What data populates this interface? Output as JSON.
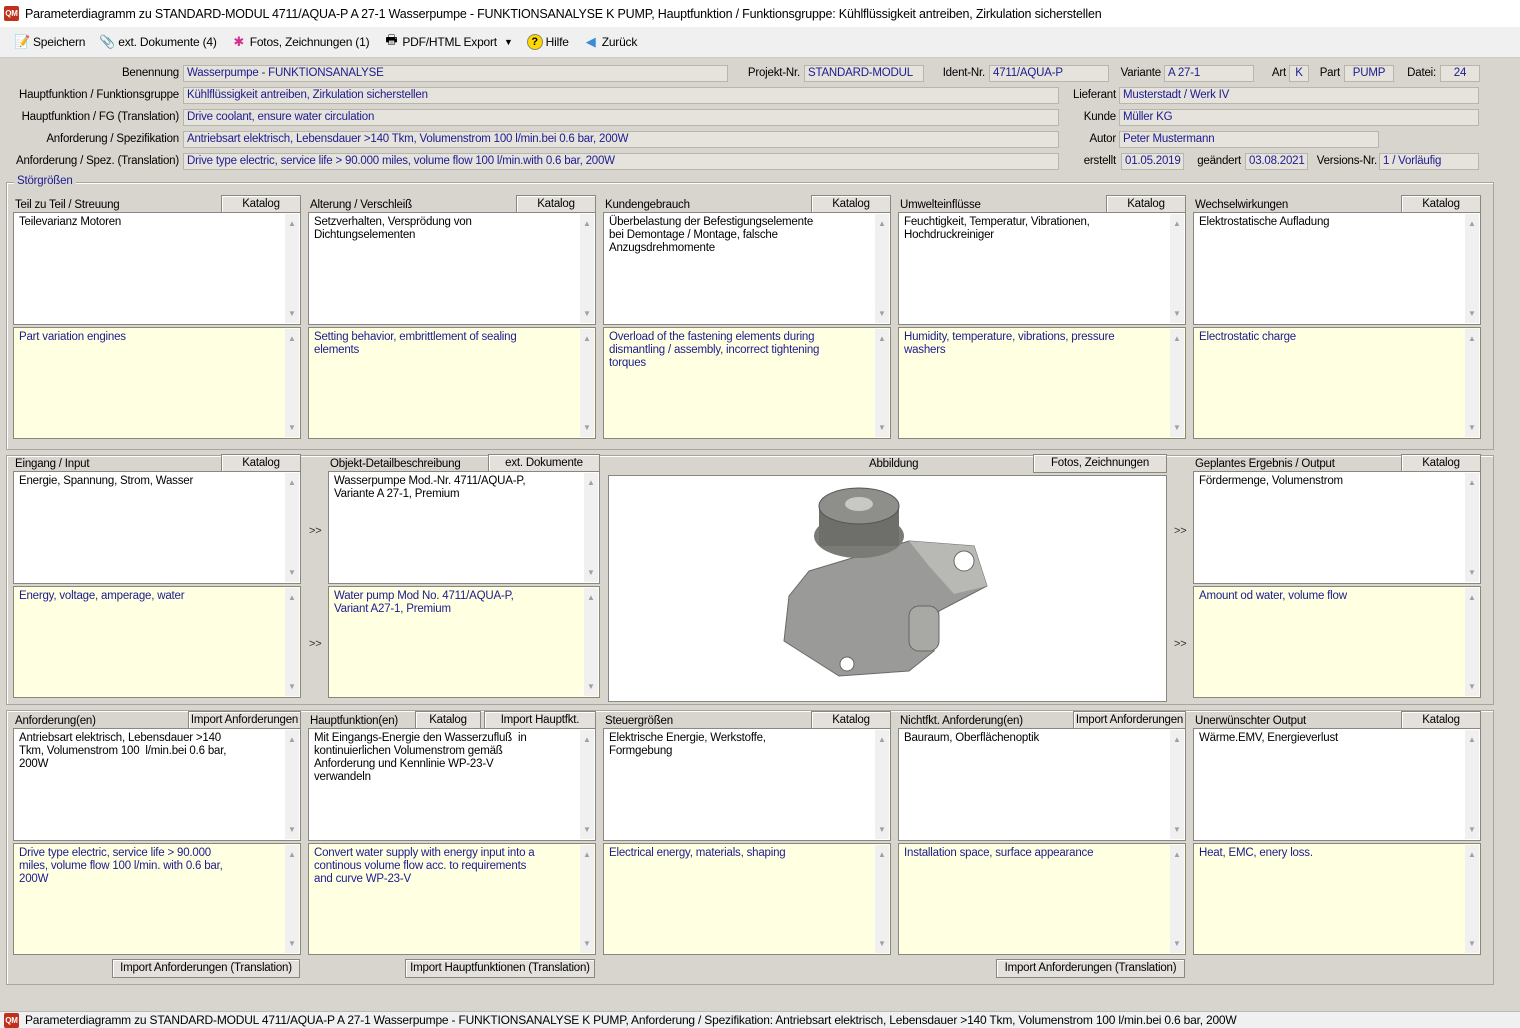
{
  "window": {
    "title": "Parameterdiagramm zu STANDARD-MODUL  4711/AQUA-P  A 27-1  Wasserpumpe - FUNKTIONSANALYSE  K  PUMP, Hauptfunktion / Funktionsgruppe: Kühlflüssigkeit antreiben, Zirkulation sicherstellen",
    "app_icon": "QM"
  },
  "toolbar": {
    "save": "Speichern",
    "ext_docs": "ext. Dokumente (4)",
    "photos": "Fotos, Zeichnungen (1)",
    "export": "PDF/HTML Export",
    "help": "Hilfe",
    "back": "Zurück"
  },
  "header": {
    "benennung_label": "Benennung",
    "benennung": "Wasserpumpe - FUNKTIONSANALYSE",
    "projekt_label": "Projekt-Nr.",
    "projekt": "STANDARD-MODUL",
    "ident_label": "Ident-Nr.",
    "ident": "4711/AQUA-P",
    "variante_label": "Variante",
    "variante": "A 27-1",
    "art_label": "Art",
    "art": "K",
    "part_label": "Part",
    "part": "PUMP",
    "datei_label": "Datei:",
    "datei": "24",
    "hf_label": "Hauptfunktion / Funktionsgruppe",
    "hf": "Kühlflüssigkeit antreiben, Zirkulation sicherstellen",
    "hf_tr_label": "Hauptfunktion / FG (Translation)",
    "hf_tr": "Drive coolant, ensure water circulation",
    "anf_label": "Anforderung / Spezifikation",
    "anf": "Antriebsart elektrisch, Lebensdauer >140 Tkm, Volumenstrom 100  l/min.bei 0.6 bar, 200W",
    "anf_tr_label": "Anforderung / Spez. (Translation)",
    "anf_tr": "Drive type electric, service life > 90.000 miles, volume flow 100  l/min.with 0.6 bar, 200W",
    "lieferant_label": "Lieferant",
    "lieferant": "Musterstadt / Werk IV",
    "kunde_label": "Kunde",
    "kunde": "Müller KG",
    "autor_label": "Autor",
    "autor": "Peter Mustermann",
    "erstellt_label": "erstellt",
    "erstellt": "01.05.2019",
    "geaendert_label": "geändert",
    "geaendert": "03.08.2021",
    "version_label": "Versions-Nr.",
    "version": "1 / Vorläufig"
  },
  "stoer": {
    "title": "Störgrößen",
    "columns": [
      {
        "title": "Teil zu Teil / Streuung",
        "buttons": [
          "Katalog"
        ],
        "de": "Teilevarianz Motoren",
        "en": "Part variation engines"
      },
      {
        "title": "Alterung / Verschleiß",
        "buttons": [
          "Katalog"
        ],
        "de": "Setzverhalten, Versprödung von\nDichtungselementen",
        "en": "Setting behavior, embrittlement of sealing\nelements"
      },
      {
        "title": "Kundengebrauch",
        "buttons": [
          "Katalog"
        ],
        "de": "Überbelastung der Befestigungselemente\nbei Demontage / Montage, falsche\nAnzugsdrehmomente",
        "en": "Overload of the fastening elements during\ndismantling / assembly, incorrect tightening\ntorques"
      },
      {
        "title": "Umwelteinflüsse",
        "buttons": [
          "Katalog"
        ],
        "de": "Feuchtigkeit, Temperatur, Vibrationen,\nHochdruckreiniger",
        "en": "Humidity, temperature, vibrations, pressure\nwashers"
      },
      {
        "title": "Wechselwirkungen",
        "buttons": [
          "Katalog"
        ],
        "de": "Elektrostatische Aufladung",
        "en": "Electrostatic charge"
      }
    ]
  },
  "middle": {
    "input": {
      "title": "Eingang / Input",
      "buttons": [
        "Katalog"
      ],
      "de": "Energie, Spannung, Strom, Wasser",
      "en": "Energy, voltage, amperage, water"
    },
    "object": {
      "title": "Objekt-Detailbeschreibung",
      "buttons": [
        "ext. Dokumente"
      ],
      "de": "Wasserpumpe Mod.-Nr. 4711/AQUA-P,\nVariante A 27-1, Premium",
      "en": "Water pump Mod No. 4711/AQUA-P,\nVariant A27-1, Premium"
    },
    "image": {
      "title": "Abbildung",
      "button": "Fotos, Zeichnungen"
    },
    "output": {
      "title": "Geplantes Ergebnis / Output",
      "buttons": [
        "Katalog"
      ],
      "de": "Fördermenge, Volumenstrom",
      "en": "Amount od water, volume flow"
    },
    "arrow": ">>"
  },
  "bottom": {
    "columns": [
      {
        "title": "Anforderung(en)",
        "buttons": [
          "Import Anforderungen"
        ],
        "de": "Antriebsart elektrisch, Lebensdauer >140\nTkm, Volumenstrom 100  l/min.bei 0.6 bar,\n200W",
        "en": "Drive type electric, service life > 90.000\nmiles, volume flow 100 l/min. with 0.6 bar,\n200W"
      },
      {
        "title": "Hauptfunktion(en)",
        "buttons": [
          "Katalog",
          "Import Hauptfkt."
        ],
        "de": "Mit Eingangs-Energie den Wasserzufluß  in\nkontinuierlichen Volumenstrom gemäß\nAnforderung und Kennlinie WP-23-V\nverwandeln",
        "en": "Convert water supply with energy input into a\ncontinous volume flow acc. to requirements\nand curve WP-23-V"
      },
      {
        "title": "Steuergrößen",
        "buttons": [
          "Katalog"
        ],
        "de": "Elektrische Energie, Werkstoffe,\nFormgebung",
        "en": "Electrical energy, materials, shaping"
      },
      {
        "title": "Nichtfkt. Anforderung(en)",
        "buttons": [
          "Import Anforderungen"
        ],
        "de": "Bauraum, Oberflächenoptik",
        "en": "Installation space, surface appearance"
      },
      {
        "title": "Unerwünschter Output",
        "buttons": [
          "Katalog"
        ],
        "de": "Wärme.EMV, Energieverlust",
        "en": "Heat, EMC, enery loss."
      }
    ],
    "import_buttons": [
      "Import Anforderungen (Translation)",
      "Import Hauptfunktionen (Translation)",
      "Import Anforderungen (Translation)"
    ]
  },
  "statusbar": {
    "text": "Parameterdiagramm zu STANDARD-MODUL  4711/AQUA-P  A 27-1  Wasserpumpe - FUNKTIONSANALYSE  K  PUMP, Anforderung / Spezifikation: Antriebsart elektrisch, Lebensdauer >140 Tkm, Volumenstrom 100  l/min.bei 0.6 bar, 200W"
  }
}
